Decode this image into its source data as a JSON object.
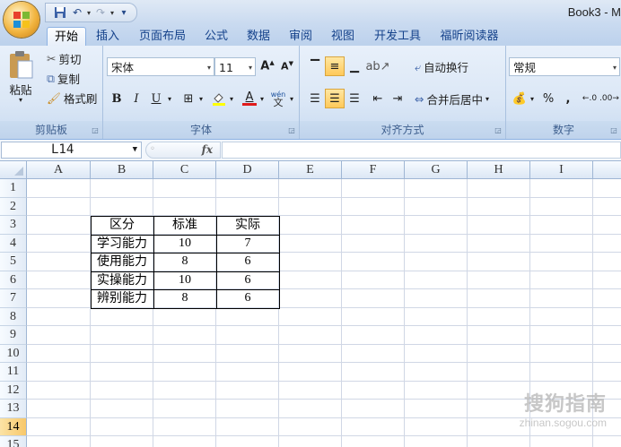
{
  "window": {
    "title": "Book3 - M"
  },
  "tabs": [
    {
      "label": "开始",
      "active": true
    },
    {
      "label": "插入"
    },
    {
      "label": "页面布局"
    },
    {
      "label": "公式"
    },
    {
      "label": "数据"
    },
    {
      "label": "审阅"
    },
    {
      "label": "视图"
    },
    {
      "label": "开发工具"
    },
    {
      "label": "福昕阅读器"
    }
  ],
  "ribbon": {
    "clipboard": {
      "group_label": "剪贴板",
      "paste": "粘贴",
      "cut": "剪切",
      "copy": "复制",
      "format_painter": "格式刷"
    },
    "font": {
      "group_label": "字体",
      "font_name": "宋体",
      "font_size": "11",
      "bold": "B",
      "italic": "I",
      "underline": "U",
      "font_color_letter": "A",
      "phonetic": "wén"
    },
    "alignment": {
      "group_label": "对齐方式",
      "wrap_text": "自动换行",
      "merge_center": "合并后居中"
    },
    "number": {
      "group_label": "数字",
      "format": "常规",
      "percent": "%",
      "comma": ","
    }
  },
  "formula_bar": {
    "name_box": "L14",
    "fx_label": "fx",
    "formula": ""
  },
  "sheet": {
    "columns": [
      "A",
      "B",
      "C",
      "D",
      "E",
      "F",
      "G",
      "H",
      "I"
    ],
    "rows": [
      "1",
      "2",
      "3",
      "4",
      "5",
      "6",
      "7",
      "8",
      "9",
      "10",
      "11",
      "12",
      "13",
      "14",
      "15"
    ],
    "selected_row": "14",
    "table": {
      "header": [
        "区分",
        "标准",
        "实际"
      ],
      "rows": [
        [
          "学习能力",
          "10",
          "7"
        ],
        [
          "使用能力",
          "8",
          "6"
        ],
        [
          "实操能力",
          "10",
          "6"
        ],
        [
          "辨别能力",
          "8",
          "6"
        ]
      ]
    }
  },
  "watermark": {
    "text": "搜狗指南",
    "url": "zhinan.sogou.com"
  },
  "colors": {
    "ribbon_bg": "#dbe7f6",
    "tab_text": "#15428b",
    "selected_row": "#f8c86a",
    "grid_line": "#d0d7e5"
  }
}
